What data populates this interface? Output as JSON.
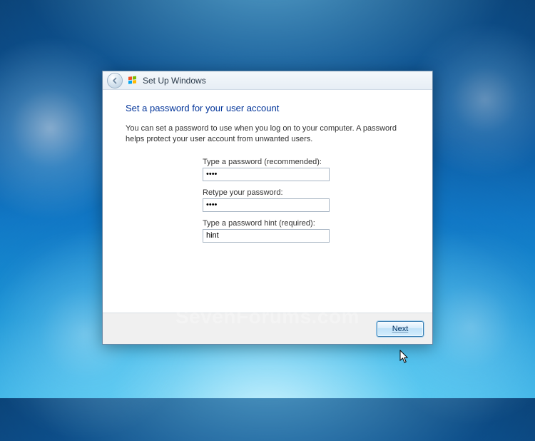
{
  "window": {
    "title": "Set Up Windows"
  },
  "heading": "Set a password for your user account",
  "description": "You can set a password to use when you log on to your computer. A password helps protect your user account from unwanted users.",
  "fields": {
    "password": {
      "label": "Type a password (recommended):",
      "value": "••••"
    },
    "retype": {
      "label": "Retype your password:",
      "value": "••••"
    },
    "hint": {
      "label": "Type a password hint (required):",
      "value": "hint"
    }
  },
  "buttons": {
    "next": "Next"
  },
  "watermark": "SevenForums.com"
}
